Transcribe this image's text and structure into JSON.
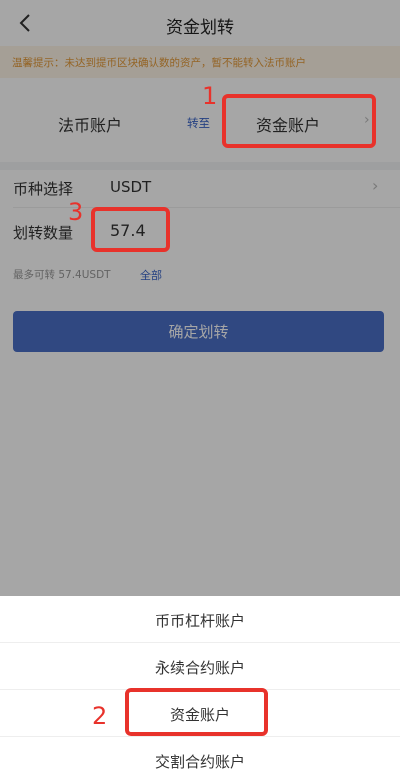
{
  "header": {
    "title": "资金划转",
    "back_icon": "chevron-left-icon"
  },
  "notice": {
    "text": "温馨提示：未达到提币区块确认数的资产，暂不能转入法币账户",
    "color": "#e49a3a"
  },
  "transfer": {
    "from_account": "法币账户",
    "to_label": "转至",
    "to_account": "资金账户"
  },
  "form": {
    "currency_label": "币种选择",
    "currency_value": "USDT",
    "amount_label": "划转数量",
    "amount_value": "57.4",
    "max_text": "最多可转 57.4USDT",
    "all_label": "全部"
  },
  "confirm_button": {
    "label": "确定划转",
    "color": "#4a6fc7"
  },
  "sheet": {
    "options": [
      "币币杠杆账户",
      "永续合约账户",
      "资金账户",
      "交割合约账户"
    ]
  },
  "annotations": {
    "marker_1": "1",
    "marker_2": "2",
    "marker_3": "3",
    "color": "#e8322b"
  }
}
